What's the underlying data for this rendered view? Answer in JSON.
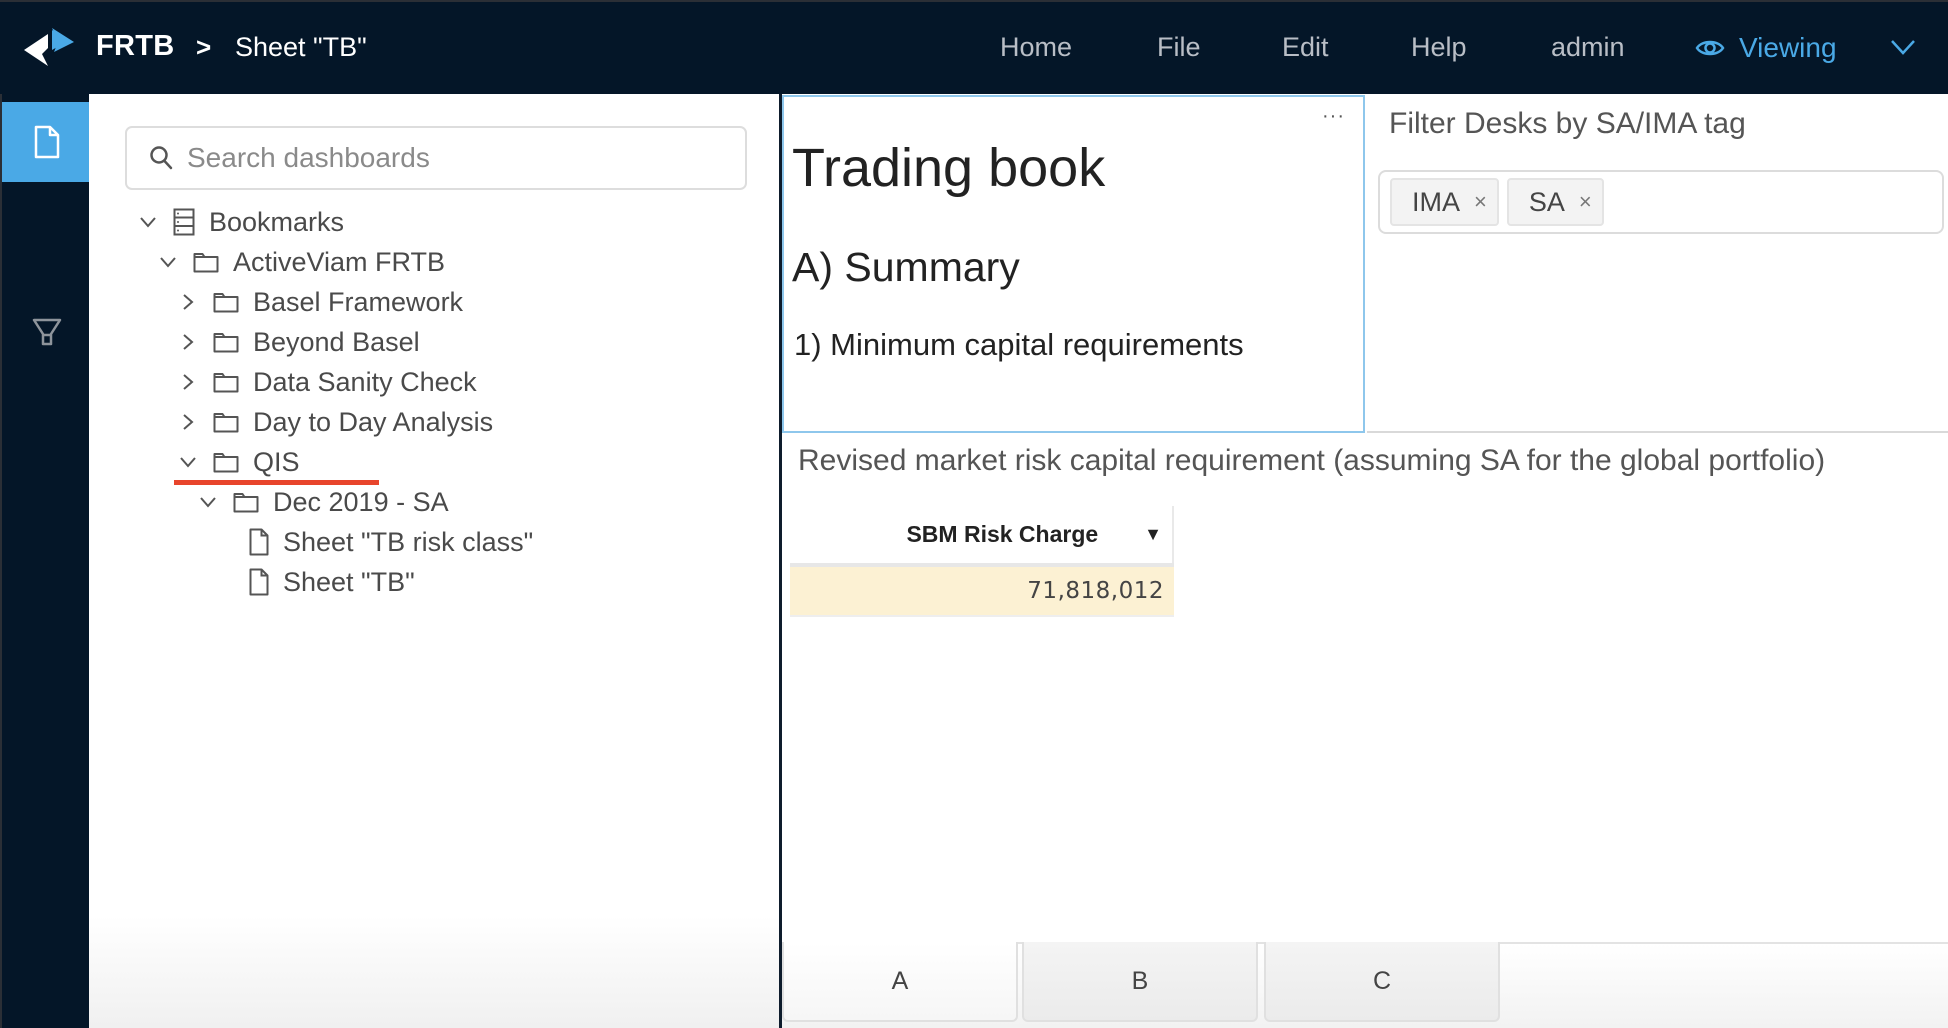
{
  "header": {
    "brand": "FRTB",
    "breadcrumb_separator": ">",
    "breadcrumb_current": "Sheet \"TB\"",
    "nav": [
      "Home",
      "File",
      "Edit",
      "Help",
      "admin"
    ],
    "mode_label": "Viewing",
    "logo_icon": "activeviam-logo",
    "mode_icon": "eye-icon",
    "menu_icon": "chevron-down-icon",
    "colors": {
      "background": "#041628",
      "accent": "#4aa9e6"
    }
  },
  "rail": {
    "items": [
      {
        "name": "dashboards",
        "icon": "file-icon",
        "active": true
      },
      {
        "name": "filters",
        "icon": "filter-icon",
        "active": false
      }
    ]
  },
  "tree_panel": {
    "search": {
      "placeholder": "Search dashboards",
      "value": ""
    },
    "items": [
      {
        "label": "Bookmarks",
        "level": 0,
        "expanded": true,
        "icon": "bookmarks-icon"
      },
      {
        "label": "ActiveViam FRTB",
        "level": 1,
        "expanded": true,
        "icon": "folder-icon"
      },
      {
        "label": "Basel Framework",
        "level": 2,
        "expanded": false,
        "icon": "folder-icon"
      },
      {
        "label": "Beyond Basel",
        "level": 2,
        "expanded": false,
        "icon": "folder-icon"
      },
      {
        "label": "Data Sanity Check",
        "level": 2,
        "expanded": false,
        "icon": "folder-icon"
      },
      {
        "label": "Day to Day Analysis",
        "level": 2,
        "expanded": false,
        "icon": "folder-icon"
      },
      {
        "label": "QIS",
        "level": 2,
        "expanded": true,
        "icon": "folder-icon",
        "highlighted": true
      },
      {
        "label": "Dec 2019 - SA",
        "level": 3,
        "expanded": true,
        "icon": "folder-icon"
      },
      {
        "label": "Sheet \"TB risk class\"",
        "level": 4,
        "icon": "file-icon"
      },
      {
        "label": "Sheet \"TB\"",
        "level": 4,
        "icon": "file-icon"
      }
    ],
    "highlight_color": "#e8452c"
  },
  "main": {
    "text_widget": {
      "menu": "···",
      "heading1": "Trading book",
      "heading2": "A) Summary",
      "heading3": "1) Minimum capital requirements"
    },
    "filter_widget": {
      "title": "Filter Desks by SA/IMA tag",
      "tags": [
        "IMA",
        "SA"
      ],
      "remove_glyph": "×"
    },
    "pivot": {
      "title": "Revised market risk capital requirement (assuming SA for the global portfolio)",
      "columns": [
        "SBM Risk Charge"
      ],
      "sort_glyph": "▼",
      "rows": [
        [
          "71,818,012"
        ]
      ],
      "cell_color": "#fcf1d3"
    },
    "tabs": [
      {
        "label": "A",
        "active": true
      },
      {
        "label": "B",
        "active": false
      },
      {
        "label": "C",
        "active": false
      }
    ]
  }
}
